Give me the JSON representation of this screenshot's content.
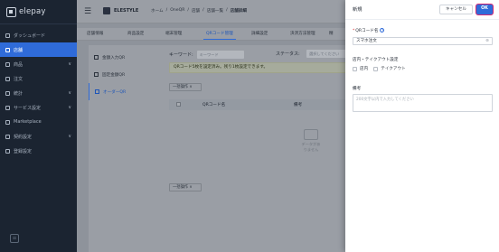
{
  "sidebar": {
    "logo": "elepay",
    "items": [
      {
        "label": "ダッシュボード",
        "active": false,
        "chevron": false
      },
      {
        "label": "店舗",
        "active": true,
        "chevron": false
      },
      {
        "label": "商品",
        "active": false,
        "chevron": true
      },
      {
        "label": "注文",
        "active": false,
        "chevron": false
      },
      {
        "label": "統計",
        "active": false,
        "chevron": true
      },
      {
        "label": "サービス設定",
        "active": false,
        "chevron": true
      },
      {
        "label": "Marketplace",
        "active": false,
        "chevron": false
      },
      {
        "label": "契約設定",
        "active": false,
        "chevron": true
      },
      {
        "label": "登録設定",
        "active": false,
        "chevron": false
      }
    ],
    "collapse_glyph": "≡"
  },
  "topbar": {
    "brand": "ELESTYLE",
    "breadcrumb": [
      "ホーム",
      "/",
      "OneQR",
      "/",
      "店舗",
      "/",
      "店舗一覧",
      "/",
      "店舗詳細"
    ]
  },
  "tabs": [
    "店舗情報",
    "商品設定",
    "端末管理",
    "QRコード管理",
    "詳細設定",
    "決済方法管理",
    "精"
  ],
  "active_tab": "QRコード管理",
  "subnav": [
    {
      "label": "金額入力QR",
      "active": false
    },
    {
      "label": "固定金額QR",
      "active": false
    },
    {
      "label": "オーダーQR",
      "active": true
    }
  ],
  "filters": {
    "keyword_label": "キーワード:",
    "keyword_placeholder": "キーワード",
    "status_label": "ステータス:",
    "status_placeholder": "選択してください"
  },
  "alert": "QRコード5枚を設定済み。残り1枚設定できます。",
  "bulk_label": "一括操作 ∨",
  "table": {
    "columns": [
      "QRコード名",
      "備考"
    ],
    "empty_text": "データがありません"
  },
  "drawer": {
    "title": "新規",
    "cancel_label": "キャンセル",
    "ok_label": "OK",
    "qr_name_label": "QRコード名",
    "qr_name_value": "スマホ注文",
    "dine_label": "店内・テイクアウト設定",
    "options": [
      "店内",
      "テイクアウト"
    ],
    "note_label": "備考",
    "note_placeholder": "200文字以内で入力してください",
    "accent": "#2f6bd9",
    "highlight": "#d62a73"
  }
}
